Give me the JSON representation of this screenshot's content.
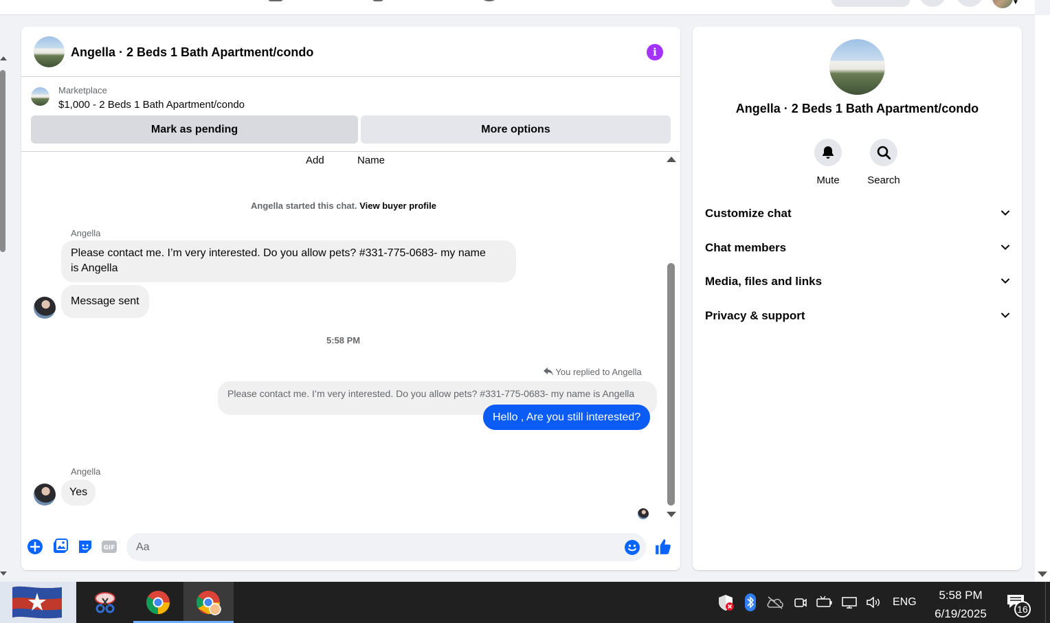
{
  "chat": {
    "title": "Angella · 2 Beds 1 Bath Apartment/condo",
    "listing": {
      "category": "Marketplace",
      "price_title": "$1,000 - 2 Beds 1 Bath Apartment/condo",
      "pending_label": "Mark as pending",
      "more_label": "More options"
    },
    "messages": {
      "partial_add": "Add",
      "partial_name": "Name",
      "started_text": "Angella started this chat.",
      "view_profile": "View buyer profile",
      "sender1": "Angella",
      "msg1_line1": "Please contact me. I’m very interested. Do you allow pets? #331-775-0683- my name",
      "msg1_line2": "is Angella",
      "msg2": "Message sent",
      "timestamp": "5:58 PM",
      "replied_label": "You replied to Angella",
      "quoted": "Please contact me. I’m very interested. Do you allow pets? #331-775-0683- my name is Angella",
      "outgoing": "Hello , Are you still interested?",
      "sender2": "Angella",
      "msg3": "Yes"
    },
    "composer": {
      "placeholder": "Aa"
    }
  },
  "info_panel": {
    "title": "Angella · 2 Beds 1 Bath Apartment/condo",
    "mute_label": "Mute",
    "search_label": "Search",
    "sections": [
      "Customize chat",
      "Chat members",
      "Media, files and links",
      "Privacy & support"
    ]
  },
  "taskbar": {
    "language": "ENG",
    "time": "5:58 PM",
    "date": "6/19/2025",
    "notification_count": "16"
  },
  "colors": {
    "accent": "#0866ff",
    "outgoing_bubble": "#0a5cf5",
    "info_icon": "#a533ff"
  }
}
